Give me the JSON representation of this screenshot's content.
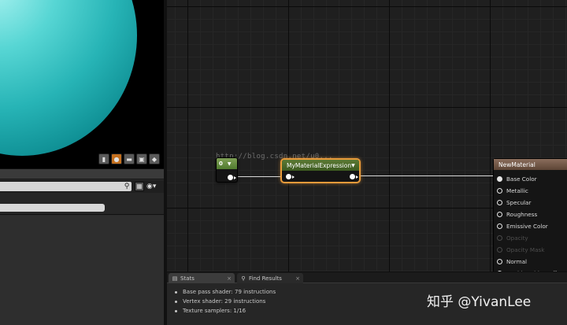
{
  "viewport": {
    "toolbar": [
      {
        "icon": "cylinder-icon",
        "glyph": "▮"
      },
      {
        "icon": "sphere-icon",
        "glyph": "●"
      },
      {
        "icon": "plane-icon",
        "glyph": "▬"
      },
      {
        "icon": "cube-icon",
        "glyph": "▣"
      },
      {
        "icon": "teapot-icon",
        "glyph": "◆"
      }
    ],
    "active_index": 1
  },
  "graph": {
    "watermark": "http://blog.csdn.net/u0...",
    "constant_node": {
      "value": "0"
    },
    "expression_node": {
      "title": "MyMaterialExpression"
    },
    "material_node": {
      "title": "NewMaterial",
      "pins": [
        {
          "label": "Base Color",
          "enabled": true,
          "connected": true
        },
        {
          "label": "Metallic",
          "enabled": true,
          "connected": false
        },
        {
          "label": "Specular",
          "enabled": true,
          "connected": false
        },
        {
          "label": "Roughness",
          "enabled": true,
          "connected": false
        },
        {
          "label": "Emissive Color",
          "enabled": true,
          "connected": false
        },
        {
          "label": "Opacity",
          "enabled": false,
          "connected": false
        },
        {
          "label": "Opacity Mask",
          "enabled": false,
          "connected": false
        },
        {
          "label": "Normal",
          "enabled": true,
          "connected": false
        },
        {
          "label": "World Position Offset",
          "enabled": true,
          "connected": false
        }
      ]
    }
  },
  "bottom_panel": {
    "tabs": [
      {
        "label": "Stats",
        "active": true
      },
      {
        "label": "Find Results",
        "active": false
      }
    ],
    "stats": [
      "Base pass shader: 79 instructions",
      "Vertex shader: 29 instructions",
      "Texture samplers: 1/16"
    ]
  },
  "brand": {
    "text": "知乎 @YivanLee"
  },
  "colors": {
    "selection_outline": "#e89a3a",
    "expression_header": "#5c7a34",
    "material_header": "#8a6d5c",
    "active_viewport_button": "#c4701f"
  }
}
